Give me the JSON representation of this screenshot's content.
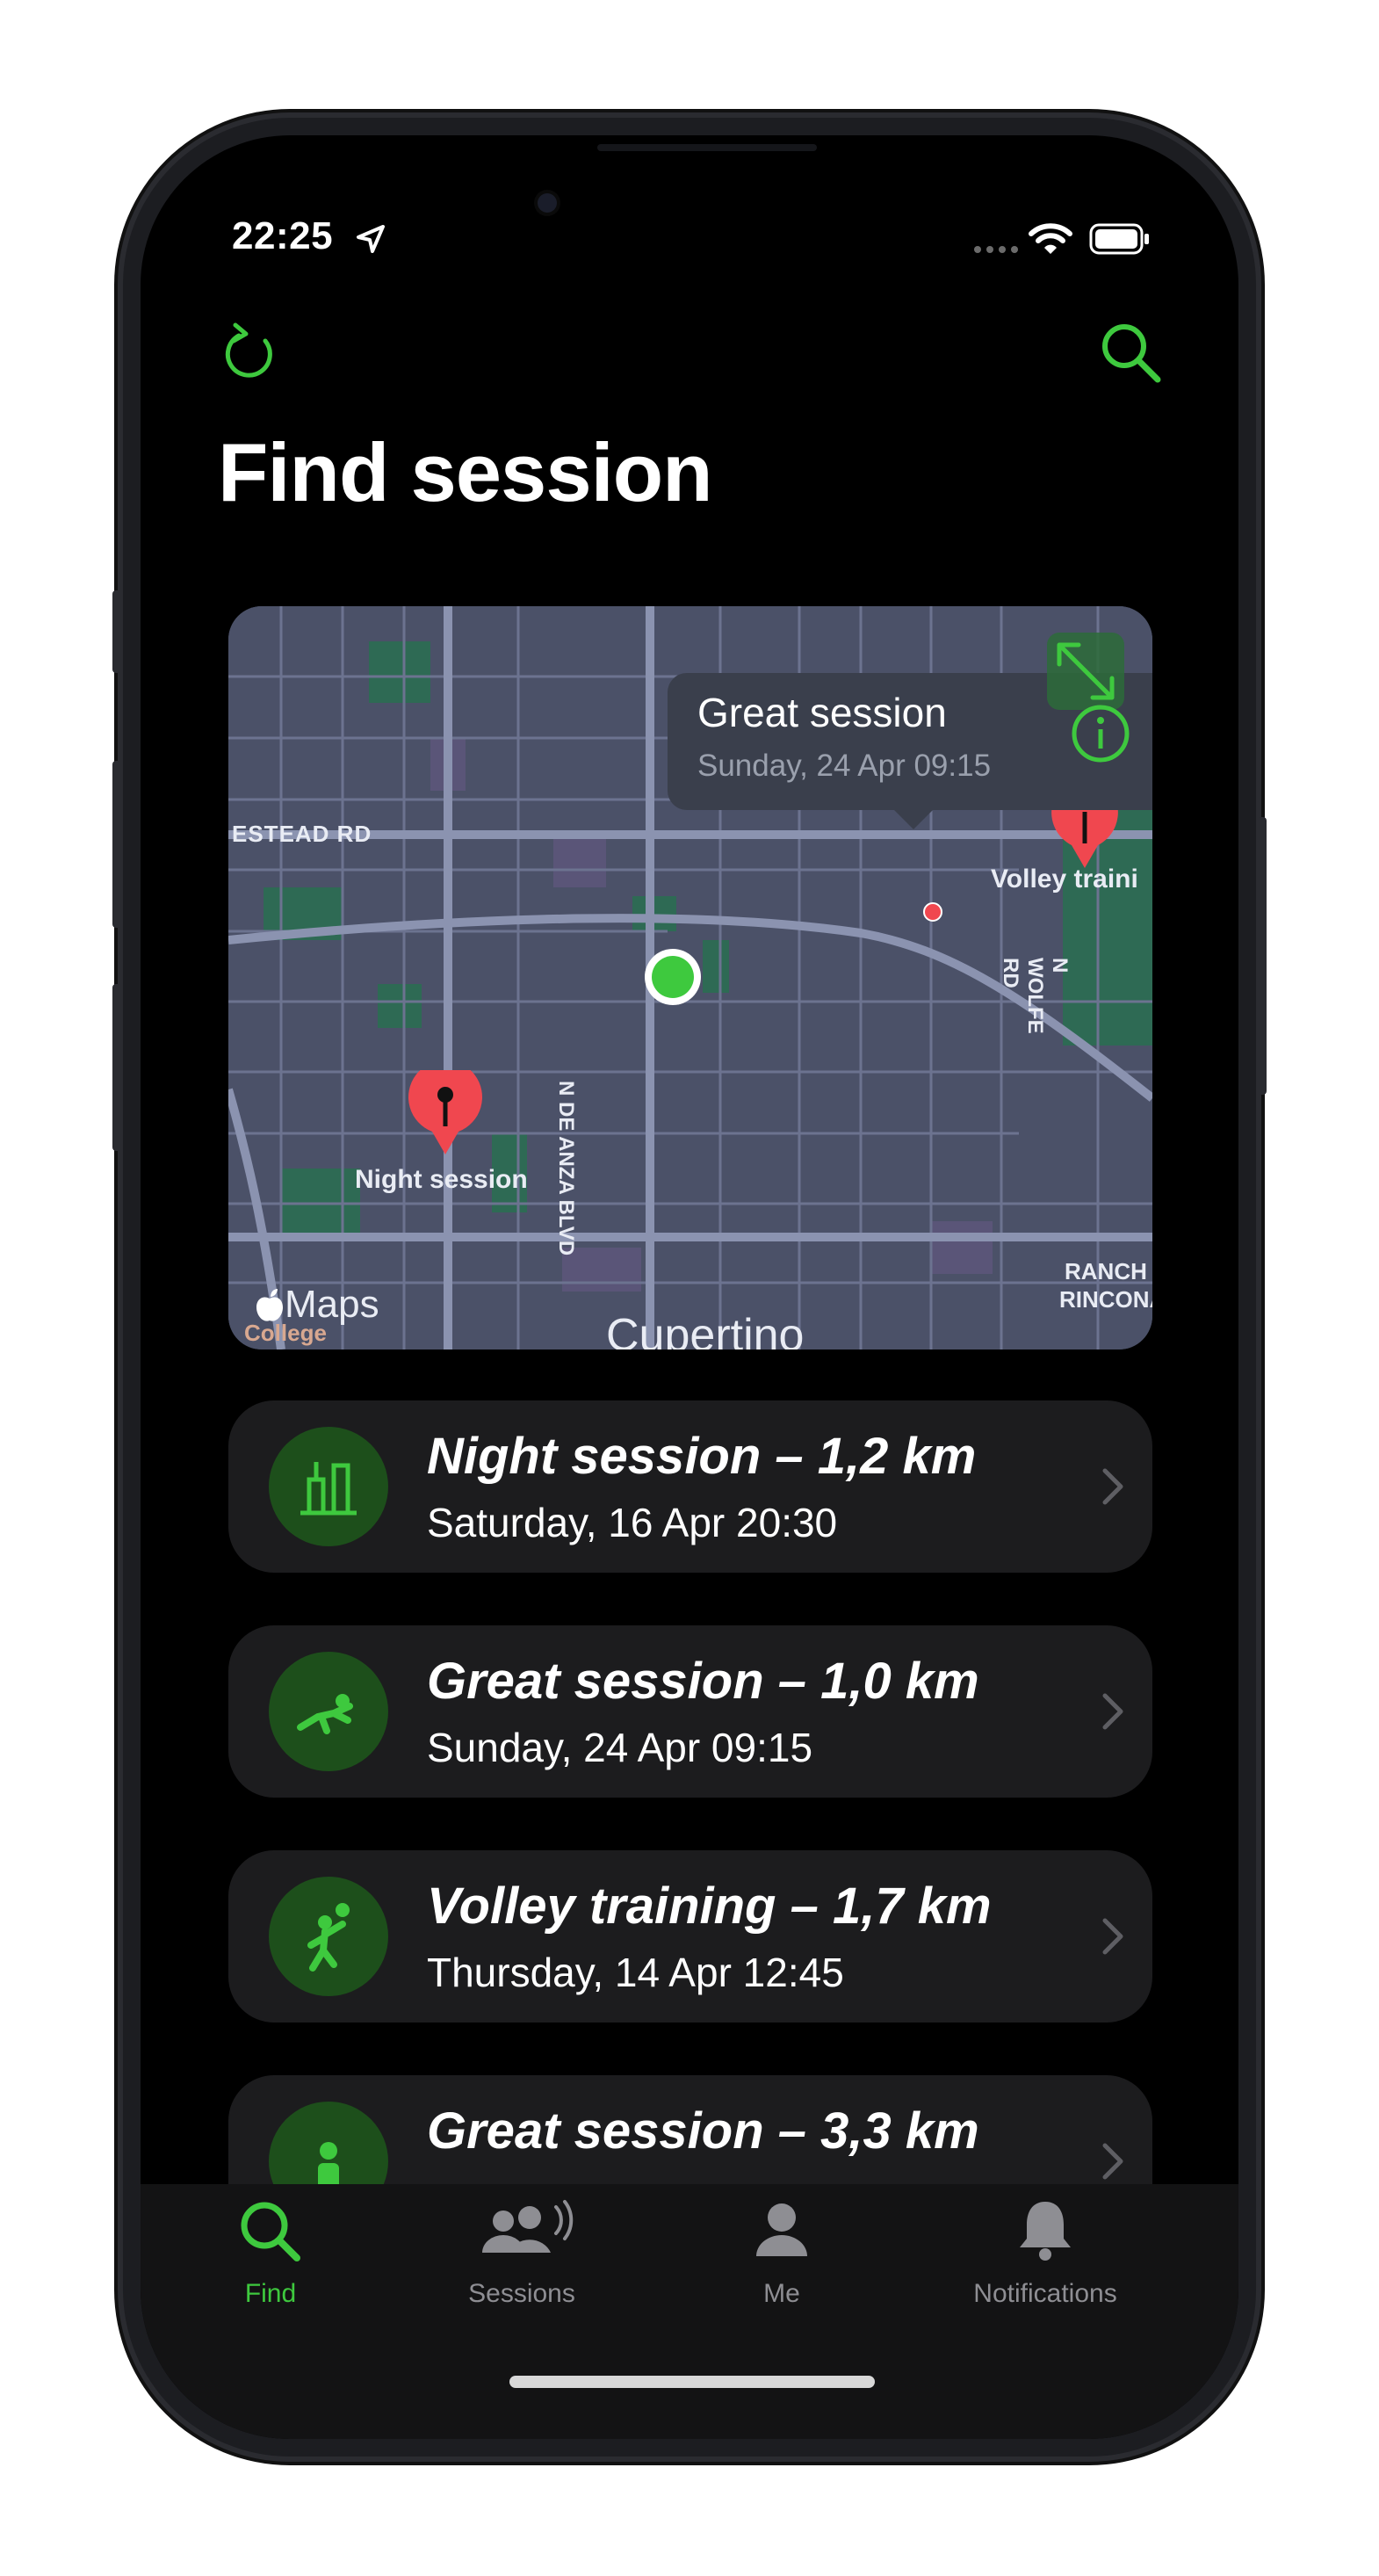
{
  "status_bar": {
    "time": "22:25"
  },
  "header": {
    "title": "Find session"
  },
  "map": {
    "callout_title": "Great session",
    "callout_subtitle": "Sunday, 24 Apr 09:15",
    "pin_labels": {
      "night": "Night session",
      "volley": "Volley traini"
    },
    "street_labels": {
      "homestead": "ESTEAD RD",
      "de_anza": "N DE ANZA BLVD",
      "wolfe": "N WOLFE RD",
      "rancho_1": "RANCH",
      "rancho_2": "RINCONA",
      "city": "Cupertino",
      "college": "College"
    },
    "attribution": "Maps"
  },
  "sessions": [
    {
      "title": "Night session – 1,2 km",
      "date": "Saturday, 16 Apr 20:30",
      "icon": "bars-icon"
    },
    {
      "title": "Great session – 1,0 km",
      "date": "Sunday, 24 Apr 09:15",
      "icon": "diving-player-icon"
    },
    {
      "title": "Volley training – 1,7 km",
      "date": "Thursday, 14 Apr 12:45",
      "icon": "volleyball-player-icon"
    },
    {
      "title": "Great session – 3,3 km",
      "date": "",
      "icon": "person-icon"
    }
  ],
  "tabs": [
    {
      "label": "Find",
      "icon": "search-icon",
      "active": true
    },
    {
      "label": "Sessions",
      "icon": "group-icon",
      "active": false
    },
    {
      "label": "Me",
      "icon": "person-icon",
      "active": false
    },
    {
      "label": "Notifications",
      "icon": "bell-icon",
      "active": false
    }
  ],
  "colors": {
    "accent": "#3ec93e",
    "pin": "#f0474f",
    "card": "#1c1c1e",
    "icon_bg": "#1d4f1b"
  }
}
